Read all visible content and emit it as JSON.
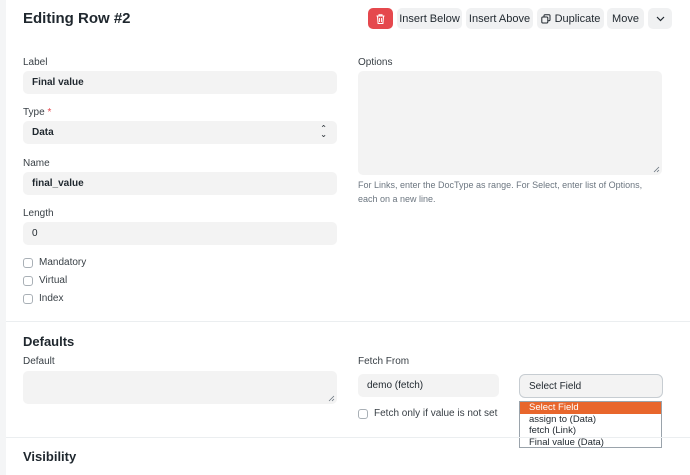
{
  "header": {
    "title": "Editing Row #2",
    "buttons": {
      "insert_below": "Insert Below",
      "insert_above": "Insert Above",
      "duplicate": "Duplicate",
      "move": "Move"
    }
  },
  "fields": {
    "label": {
      "label": "Label",
      "value": "Final value"
    },
    "type": {
      "label": "Type",
      "required_mark": "*",
      "value": "Data"
    },
    "name": {
      "label": "Name",
      "value": "final_value"
    },
    "length": {
      "label": "Length",
      "value": "0"
    },
    "options": {
      "label": "Options",
      "description": "For Links, enter the DocType as range. For Select, enter list of Options, each on a new line."
    },
    "checkboxes": [
      "Mandatory",
      "Virtual",
      "Index"
    ]
  },
  "defaults": {
    "title": "Defaults",
    "default_label": "Default",
    "fetch_from_label": "Fetch From",
    "fetch_from_value": "demo (fetch)",
    "select_field_value": "Select Field",
    "fetch_if_empty_label": "Fetch only if value is not set",
    "dropdown_options": [
      "Select Field",
      "assign to (Data)",
      "fetch (Link)",
      "Final value (Data)"
    ],
    "dropdown_selected_index": 0
  },
  "visibility": {
    "title": "Visibility"
  },
  "colors": {
    "delete_button": "#e5484d",
    "dropdown_highlight": "#e8662c"
  }
}
